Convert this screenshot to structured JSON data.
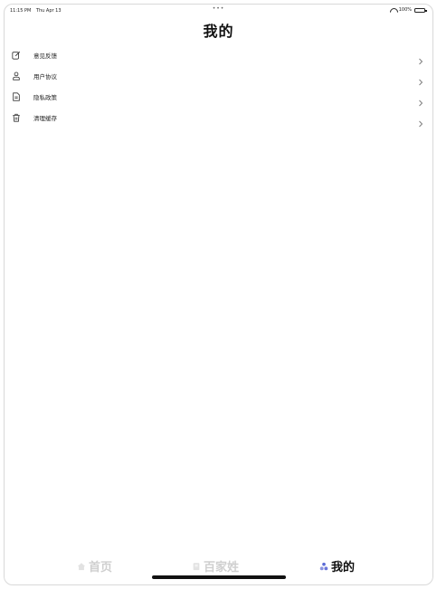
{
  "status_bar": {
    "time": "11:15 PM",
    "date": "Thu Apr 13",
    "dots": "•••",
    "battery": "100%"
  },
  "page": {
    "title": "我的"
  },
  "menu": {
    "items": [
      {
        "label": "意见反馈",
        "icon": "edit-icon"
      },
      {
        "label": "用户协议",
        "icon": "user-icon"
      },
      {
        "label": "隐私政策",
        "icon": "document-icon"
      },
      {
        "label": "清理缓存",
        "icon": "trash-icon"
      }
    ],
    "chevron": "›"
  },
  "tabs": [
    {
      "label": "首页",
      "icon": "home-icon",
      "active": false
    },
    {
      "label": "百家姓",
      "icon": "book-icon",
      "active": false
    },
    {
      "label": "我的",
      "icon": "profile-icon",
      "active": true
    }
  ],
  "colors": {
    "active_tab": "#111111",
    "inactive_tab": "#cfcfcf",
    "profile_icon_accent": "#5b6bd6"
  }
}
